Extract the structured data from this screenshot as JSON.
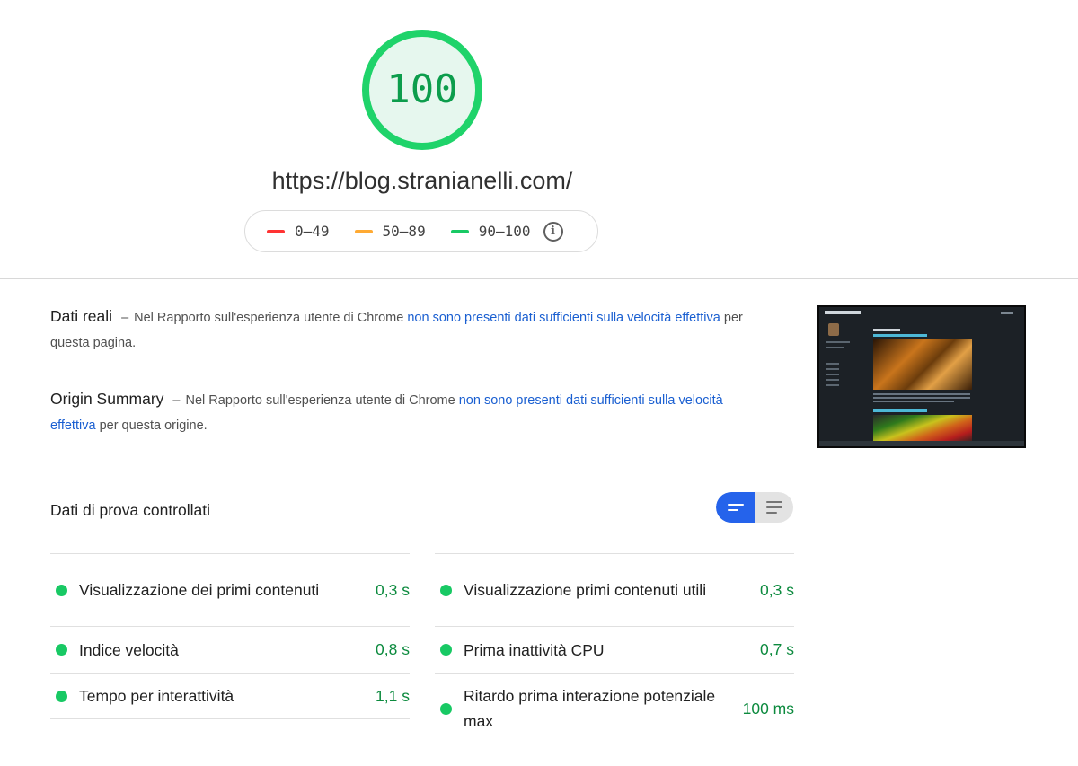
{
  "score": {
    "value": "100",
    "color": "#0cce6b",
    "fill": "#e6f7ee"
  },
  "url": "https://blog.stranianelli.com/",
  "legend": {
    "items": [
      {
        "label": "0–49",
        "color": "#ff3333"
      },
      {
        "label": "50–89",
        "color": "#ffaa33"
      },
      {
        "label": "90–100",
        "color": "#0cce6b"
      }
    ],
    "info_icon": "info-icon"
  },
  "field_data": {
    "title": "Dati reali",
    "text_before": "Nel Rapporto sull'esperienza utente di Chrome",
    "link": "non sono presenti dati sufficienti sulla velocità effettiva",
    "text_after": "per questa pagina."
  },
  "origin_summary": {
    "title": "Origin Summary",
    "text_before": "Nel Rapporto sull'esperienza utente di Chrome",
    "link": "non sono presenti dati sufficienti sulla velocità effettiva",
    "text_after": "per questa origine."
  },
  "lab_data": {
    "title": "Dati di prova controllati",
    "metrics_left": [
      {
        "label": "Visualizzazione dei primi contenuti",
        "value": "0,3 s"
      },
      {
        "label": "Indice velocità",
        "value": "0,8 s"
      },
      {
        "label": "Tempo per interattività",
        "value": "1,1 s"
      }
    ],
    "metrics_right": [
      {
        "label": "Visualizzazione primi contenuti utili",
        "value": "0,3 s"
      },
      {
        "label": "Prima inattività CPU",
        "value": "0,7 s"
      },
      {
        "label": "Ritardo prima interazione potenziale max",
        "value": "100 ms"
      }
    ],
    "status_color": "#0cce6b"
  },
  "view_toggle": {
    "active": "compact-view",
    "options": [
      "compact-view-icon",
      "list-view-icon"
    ]
  }
}
